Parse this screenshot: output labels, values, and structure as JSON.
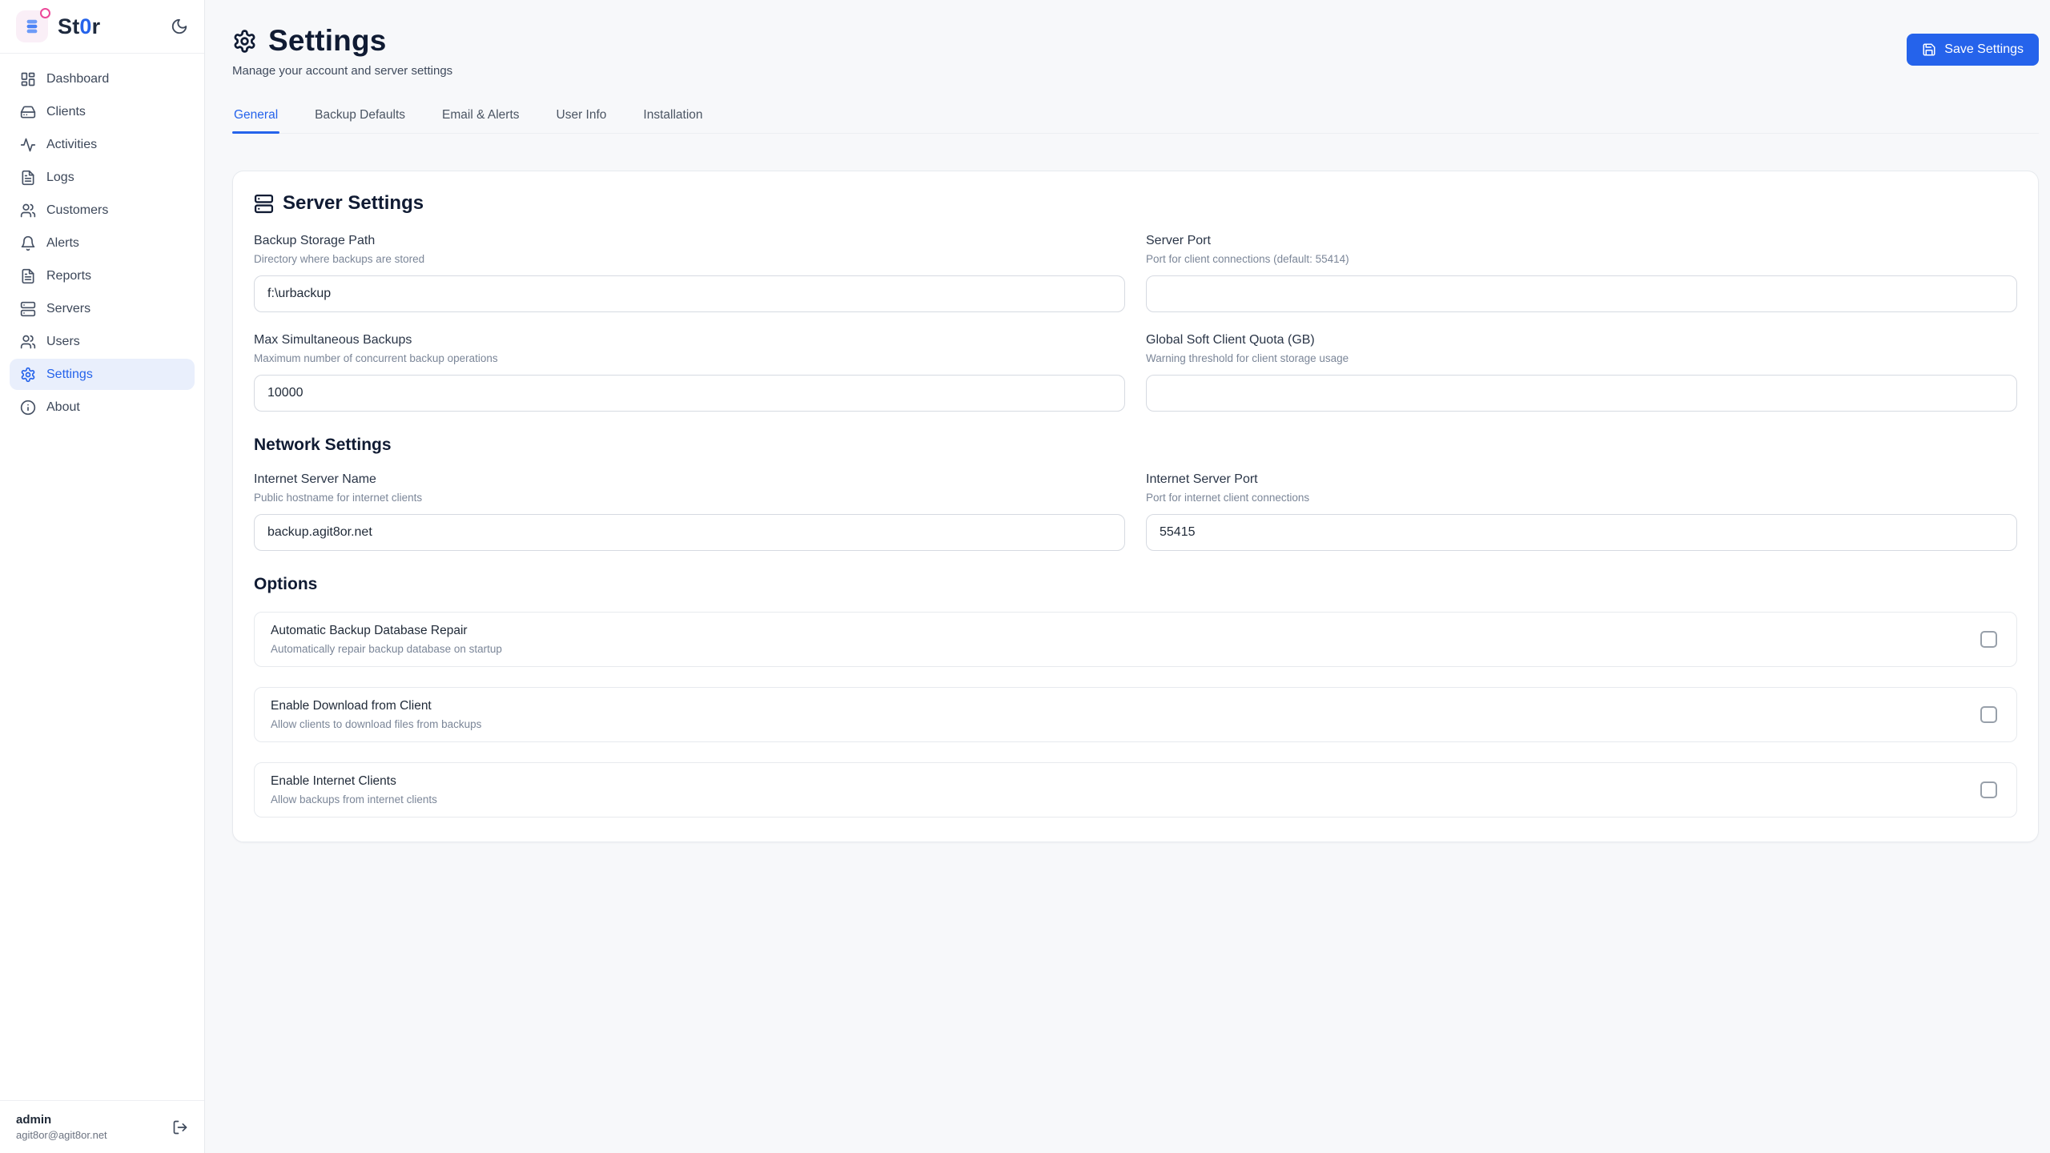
{
  "brand": {
    "prefix": "St",
    "zero": "0",
    "suffix": "r"
  },
  "sidebar": {
    "items": [
      {
        "label": "Dashboard"
      },
      {
        "label": "Clients"
      },
      {
        "label": "Activities"
      },
      {
        "label": "Logs"
      },
      {
        "label": "Customers"
      },
      {
        "label": "Alerts"
      },
      {
        "label": "Reports"
      },
      {
        "label": "Servers"
      },
      {
        "label": "Users"
      },
      {
        "label": "Settings"
      },
      {
        "label": "About"
      }
    ],
    "user": {
      "name": "admin",
      "email": "agit8or@agit8or.net"
    }
  },
  "header": {
    "title": "Settings",
    "subtitle": "Manage your account and server settings",
    "save_button": "Save Settings"
  },
  "tabs": [
    {
      "label": "General"
    },
    {
      "label": "Backup Defaults"
    },
    {
      "label": "Email & Alerts"
    },
    {
      "label": "User Info"
    },
    {
      "label": "Installation"
    }
  ],
  "server_settings": {
    "title": "Server Settings",
    "fields": {
      "backup_storage_path": {
        "label": "Backup Storage Path",
        "help": "Directory where backups are stored",
        "value": "f:\\urbackup"
      },
      "server_port": {
        "label": "Server Port",
        "help": "Port for client connections (default: 55414)",
        "value": ""
      },
      "max_simultaneous_backups": {
        "label": "Max Simultaneous Backups",
        "help": "Maximum number of concurrent backup operations",
        "value": "10000"
      },
      "global_soft_client_quota": {
        "label": "Global Soft Client Quota (GB)",
        "help": "Warning threshold for client storage usage",
        "value": ""
      }
    }
  },
  "network_settings": {
    "title": "Network Settings",
    "fields": {
      "internet_server_name": {
        "label": "Internet Server Name",
        "help": "Public hostname for internet clients",
        "value": "backup.agit8or.net"
      },
      "internet_server_port": {
        "label": "Internet Server Port",
        "help": "Port for internet client connections",
        "value": "55415"
      }
    }
  },
  "options": {
    "title": "Options",
    "items": [
      {
        "label": "Automatic Backup Database Repair",
        "help": "Automatically repair backup database on startup",
        "checked": false
      },
      {
        "label": "Enable Download from Client",
        "help": "Allow clients to download files from backups",
        "checked": false
      },
      {
        "label": "Enable Internet Clients",
        "help": "Allow backups from internet clients",
        "checked": false
      }
    ]
  }
}
